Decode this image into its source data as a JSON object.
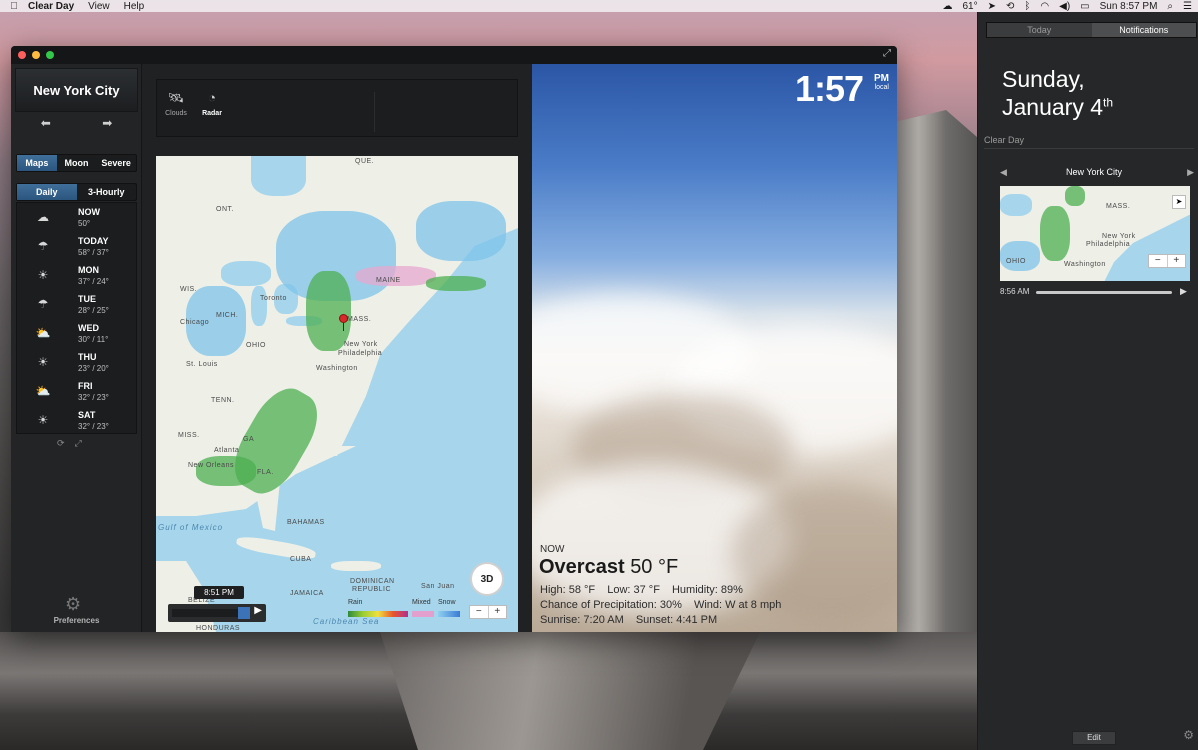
{
  "menubar": {
    "app_name": "Clear Day",
    "menus": [
      "View",
      "Help"
    ],
    "status_temp": "61°",
    "clock": "Sun 8:57 PM"
  },
  "sidebar": {
    "city": "New York City",
    "map_tabs": [
      "Maps",
      "Moon",
      "Severe"
    ],
    "map_tab_active": "Maps",
    "range_tabs": [
      "Daily",
      "3-Hourly"
    ],
    "range_tab_active": "Daily",
    "forecast": [
      {
        "day": "NOW",
        "temp": "50°",
        "icon": "cloud-icon"
      },
      {
        "day": "TODAY",
        "temp": "58° / 37°",
        "icon": "rain-cloud-icon"
      },
      {
        "day": "MON",
        "temp": "37° / 24°",
        "icon": "sun-icon"
      },
      {
        "day": "TUE",
        "temp": "28° / 25°",
        "icon": "rain-cloud-icon"
      },
      {
        "day": "WED",
        "temp": "30° / 11°",
        "icon": "partly-cloudy-icon"
      },
      {
        "day": "THU",
        "temp": "23° / 20°",
        "icon": "sun-icon"
      },
      {
        "day": "FRI",
        "temp": "32° / 23°",
        "icon": "partly-cloudy-icon"
      },
      {
        "day": "SAT",
        "temp": "32° / 23°",
        "icon": "sun-icon"
      }
    ],
    "preferences_label": "Preferences"
  },
  "toolbar": {
    "clouds_label": "Clouds",
    "radar_label": "Radar"
  },
  "map": {
    "labels": {
      "que": "QUE.",
      "ont": "ONT.",
      "maine": "MAINE",
      "wis": "WIS.",
      "toronto": "Toronto",
      "mich": "MICH.",
      "chicago": "Chicago",
      "mass": "MASS.",
      "ohio": "OHIO",
      "newyork": "New York",
      "philadelphia": "Philadelphia",
      "stlouis": "St. Louis",
      "washington": "Washington",
      "tenn": "TENN.",
      "atlanta": "Atlanta",
      "miss": "MISS.",
      "ga": "GA",
      "neworleans": "New Orleans",
      "fla": "FLA.",
      "gulf": "Gulf of Mexico",
      "bahamas": "BAHAMAS",
      "cuba": "CUBA",
      "dominican": "DOMINICAN",
      "republic": "REPUBLIC",
      "sanjuan": "San Juan",
      "jamaica": "JAMAICA",
      "belize": "BELIZE",
      "honduras": "HONDURAS",
      "caribbean": "Caribbean Sea"
    },
    "legend": [
      "Rain",
      "Mixed",
      "Snow"
    ],
    "btn_3d": "3D",
    "zoom_out": "−",
    "zoom_in": "+",
    "playback_time": "8:51 PM"
  },
  "weather": {
    "time": "1:57",
    "ampm": "PM",
    "time_zone_label": "local",
    "now_label": "NOW",
    "condition": "Overcast",
    "temperature": "50 °F",
    "high": "High: 58 °F",
    "low": "Low: 37 °F",
    "humidity": "Humidity: 89%",
    "precip": "Chance of Precipitation: 30%",
    "wind": "Wind: W at 8 mph",
    "sunrise": "Sunrise: 7:20 AM",
    "sunset": "Sunset: 4:41 PM"
  },
  "notification_center": {
    "tabs": [
      "Today",
      "Notifications"
    ],
    "active_tab": "Notifications",
    "date_line1": "Sunday,",
    "date_line2": "January 4",
    "date_suffix": "th",
    "section_title": "Clear Day",
    "widget_city": "New York City",
    "widget_map_labels": {
      "mass": "MASS.",
      "newyork": "New York",
      "philadelphia": "Philadelphia",
      "washington": "Washington",
      "ohio": "OHIO"
    },
    "widget_time": "8:56 AM",
    "zoom_out": "−",
    "zoom_in": "+",
    "edit_label": "Edit"
  }
}
